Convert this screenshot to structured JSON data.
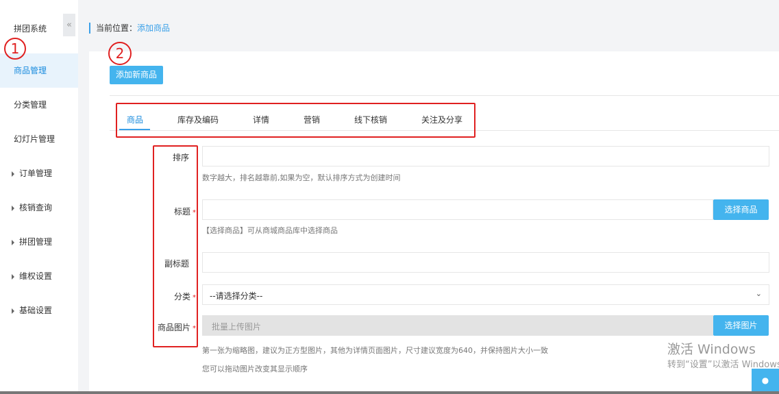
{
  "sidebar": {
    "title": "拼团系统",
    "collapse_icon": "«",
    "items": [
      {
        "label": "商品管理",
        "active": true
      },
      {
        "label": "分类管理"
      },
      {
        "label": "幻灯片管理"
      },
      {
        "label": "订单管理",
        "expandable": true
      },
      {
        "label": "核销查询",
        "expandable": true
      },
      {
        "label": "拼团管理",
        "expandable": true
      },
      {
        "label": "维权设置",
        "expandable": true
      },
      {
        "label": "基础设置",
        "expandable": true
      }
    ]
  },
  "annotations": {
    "marker1": "1",
    "marker2": "2"
  },
  "breadcrumb": {
    "prefix": "当前位置：",
    "current": "添加商品"
  },
  "toolbar": {
    "add_button": "添加新商品"
  },
  "tabs": [
    "商品",
    "库存及编码",
    "详情",
    "营销",
    "线下核销",
    "关注及分享"
  ],
  "form": {
    "sort": {
      "label": "排序",
      "hint": "数字越大，排名越靠前,如果为空，默认排序方式为创建时间"
    },
    "title": {
      "label": "标题",
      "button": "选择商品",
      "hint": "【选择商品】可从商城商品库中选择商品"
    },
    "subtitle": {
      "label": "副标题"
    },
    "category": {
      "label": "分类",
      "selected": "--请选择分类--"
    },
    "images": {
      "label": "商品图片",
      "upload_placeholder": "批量上传图片",
      "button": "选择图片",
      "hint1": "第一张为缩略图，建议为正方型图片，其他为详情页面图片，尺寸建议宽度为640，并保持图片大小一致",
      "hint2": "您可以拖动图片改变其显示顺序"
    },
    "required_mark": "*"
  },
  "watermark": {
    "line1": "激活 Windows",
    "line2": "转到“设置”以激活 Windows。"
  },
  "colors": {
    "accent": "#44b4ee",
    "annotation_red": "#e02020",
    "link": "#3aa0e8"
  }
}
